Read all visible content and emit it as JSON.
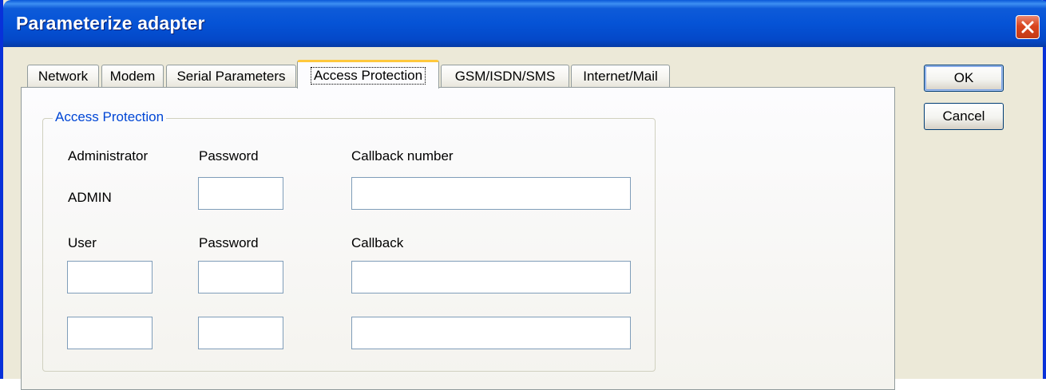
{
  "window": {
    "title": "Parameterize adapter",
    "close_icon": "close-x-icon",
    "accent_color": "#0553d6"
  },
  "tabs": [
    {
      "label": "Network",
      "active": false
    },
    {
      "label": "Modem",
      "active": false
    },
    {
      "label": "Serial Parameters",
      "active": false
    },
    {
      "label": "Access Protection",
      "active": true
    },
    {
      "label": "GSM/ISDN/SMS",
      "active": false
    },
    {
      "label": "Internet/Mail",
      "active": false
    }
  ],
  "group": {
    "legend": "Access Protection",
    "headers": {
      "administrator": "Administrator",
      "password": "Password",
      "callback_number": "Callback number"
    },
    "admin": {
      "name": "ADMIN",
      "password": "",
      "callback_number": ""
    },
    "user_headers": {
      "user": "User",
      "password": "Password",
      "callback": "Callback"
    },
    "users": [
      {
        "user": "",
        "password": "",
        "callback": ""
      },
      {
        "user": "",
        "password": "",
        "callback": ""
      }
    ]
  },
  "buttons": {
    "ok": "OK",
    "cancel": "Cancel"
  }
}
